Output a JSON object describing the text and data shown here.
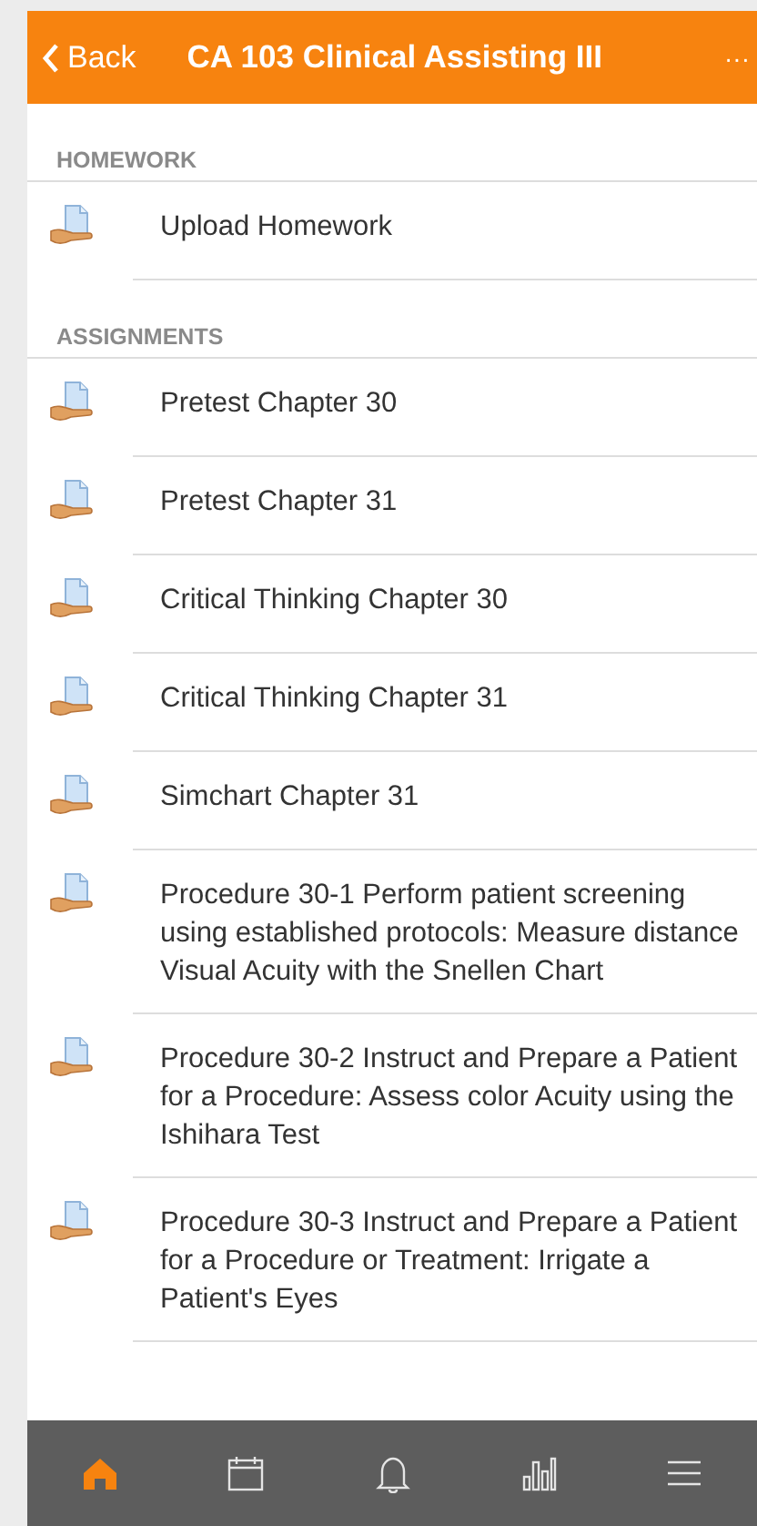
{
  "header": {
    "back": "Back",
    "title": "CA 103 Clinical Assisting III",
    "more": "···"
  },
  "sections": [
    {
      "title": "HOMEWORK",
      "items": [
        {
          "label": "Upload Homework"
        }
      ]
    },
    {
      "title": "ASSIGNMENTS",
      "items": [
        {
          "label": "Pretest Chapter 30"
        },
        {
          "label": "Pretest Chapter 31"
        },
        {
          "label": "Critical Thinking Chapter 30"
        },
        {
          "label": "Critical Thinking Chapter 31"
        },
        {
          "label": "Simchart Chapter 31"
        },
        {
          "label": "Procedure 30-1 Perform patient screening using established protocols: Measure distance Visual Acuity with the Snellen Chart"
        },
        {
          "label": "Procedure 30-2 Instruct and Prepare a Patient for a Procedure: Assess color Acuity using the Ishihara Test"
        },
        {
          "label": "Procedure 30-3 Instruct and Prepare a Patient for a Procedure or Treatment: Irrigate a Patient's Eyes"
        }
      ]
    }
  ],
  "tabbar": [
    {
      "kind": "home",
      "selected": true
    },
    {
      "kind": "calendar",
      "selected": false
    },
    {
      "kind": "bell",
      "selected": false
    },
    {
      "kind": "chart",
      "selected": false
    },
    {
      "kind": "menu",
      "selected": false
    }
  ]
}
